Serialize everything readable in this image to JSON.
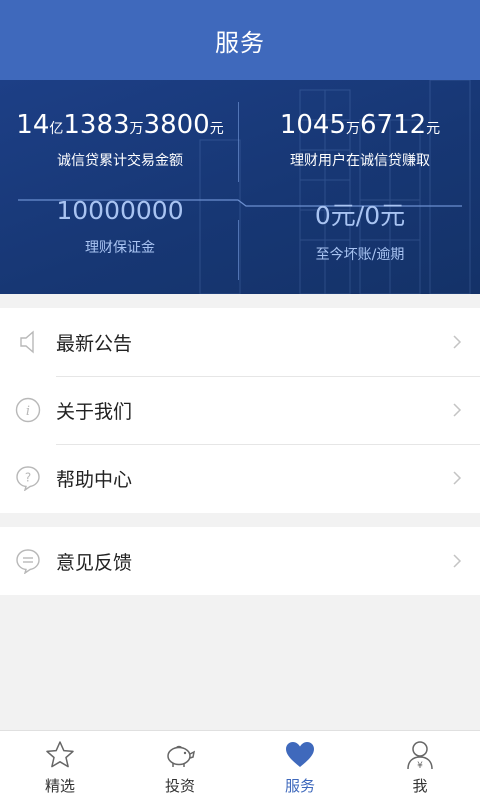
{
  "header": {
    "title": "服务"
  },
  "stats": {
    "total_trade": {
      "v1": "14",
      "u1": "亿",
      "v2": "1383",
      "u2": "万",
      "v3": "3800",
      "u3": "元",
      "label": "诚信贷累计交易金额"
    },
    "user_earned": {
      "v1": "1045",
      "u1": "万",
      "v2": "6712",
      "u2": "元",
      "label": "理财用户在诚信贷赚取"
    },
    "guarantee": {
      "value": "10000000",
      "label": "理财保证金"
    },
    "bad_debt": {
      "value": "0元/0元",
      "label": "至今坏账/逾期"
    }
  },
  "menu": {
    "announcements": "最新公告",
    "about": "关于我们",
    "help": "帮助中心",
    "feedback": "意见反馈"
  },
  "tabs": [
    {
      "label": "精选",
      "icon": "star-icon"
    },
    {
      "label": "投资",
      "icon": "piggy-bank-icon"
    },
    {
      "label": "服务",
      "icon": "heart-icon"
    },
    {
      "label": "我",
      "icon": "user-yen-icon"
    }
  ],
  "colors": {
    "brand": "#3f69bc",
    "stats_bg": "#173774",
    "muted_text": "#a9c4f2"
  }
}
